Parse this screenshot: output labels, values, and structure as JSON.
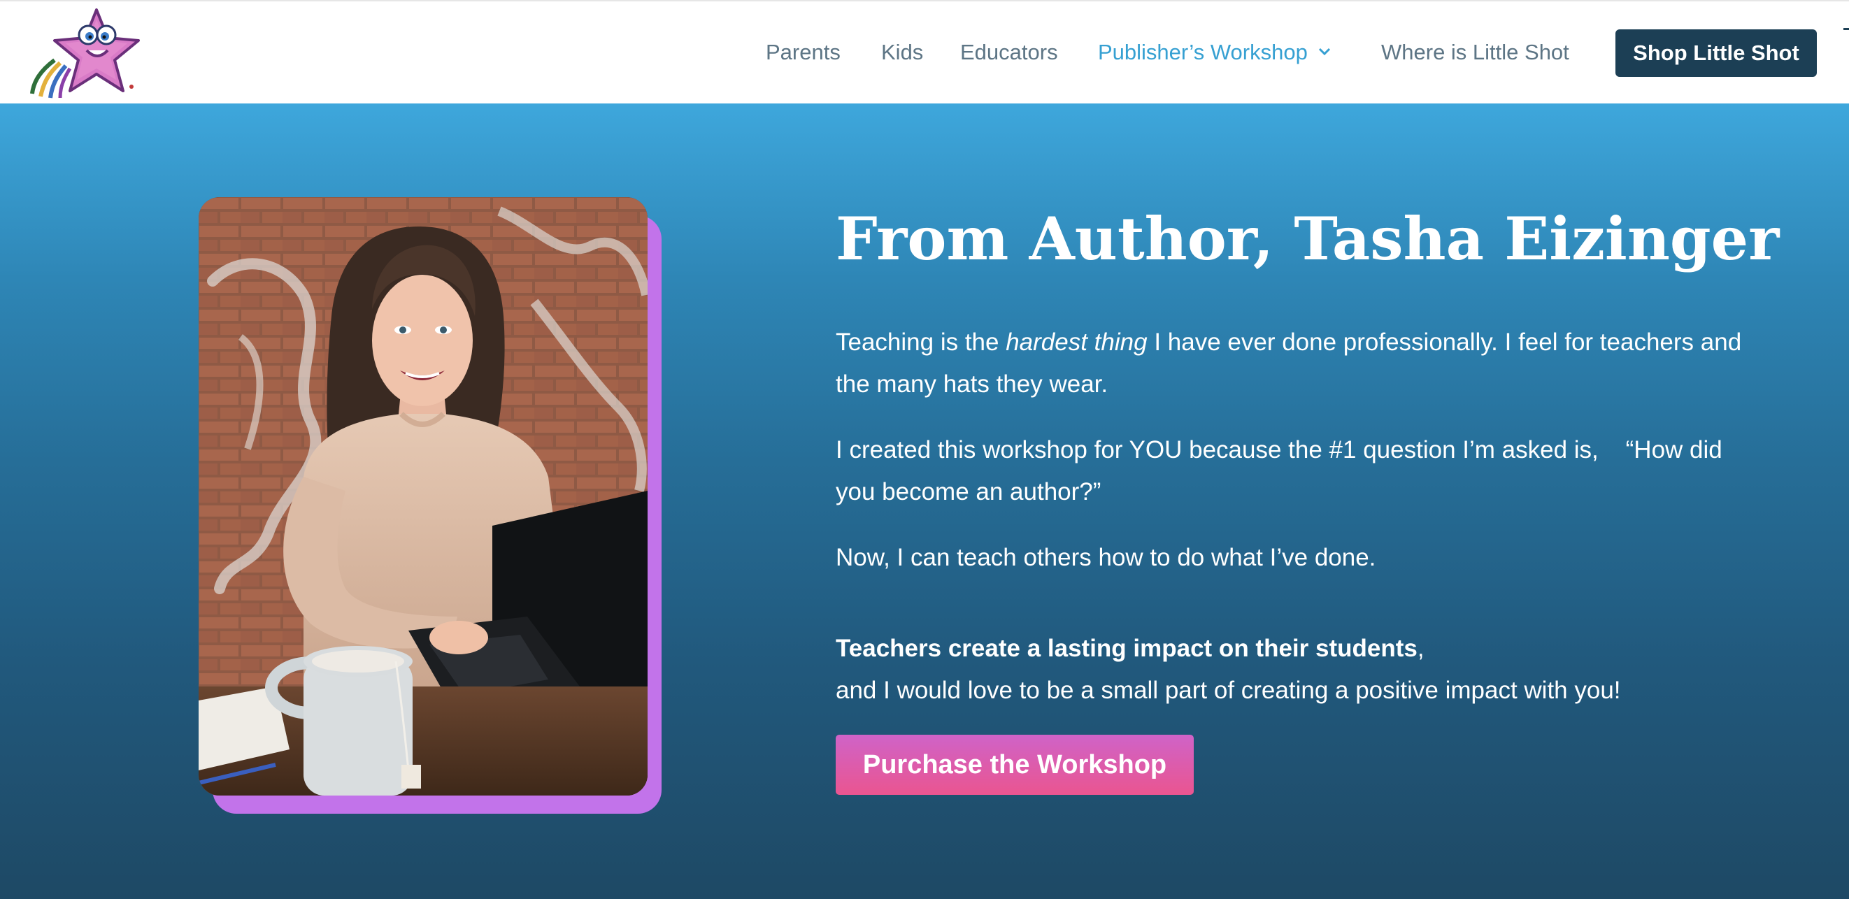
{
  "header": {
    "logo_alt": "Little Shot",
    "nav": [
      {
        "label": "Parents"
      },
      {
        "label": "Kids"
      },
      {
        "label": "Educators"
      },
      {
        "label": "Publisher’s Workshop"
      },
      {
        "label": "Where is Little Shot"
      }
    ],
    "shop_button": "Shop Little Shot"
  },
  "hero": {
    "title": "From Author, Tasha Eizinger",
    "p1_before": "Teaching is the ",
    "p1_em": "hardest thing",
    "p1_after": " I have ever done professionally. I feel for teachers and the many hats they wear.",
    "p2": "I created this workshop for YOU because the #1 question I’m asked is,    “How did you become an author?”",
    "p3": "Now, I can teach others how to do what I’ve done.",
    "p4_strong": "Teachers create a lasting impact on their students",
    "p4_comma": ",",
    "p4_line2": "and I would love to be a small part of creating a positive impact with you!",
    "cta": "Purchase the Workshop",
    "photo_alt": "Tasha Eizinger at a laptop with a mug"
  },
  "colors": {
    "nav_text": "#5d7585",
    "nav_active": "#36a0d2",
    "shop_button_bg": "#1c3f55",
    "hero_top": "#3ea7dc",
    "hero_bottom": "#1e4965",
    "photo_accent": "#c273ea",
    "cta_top": "#cf63c8",
    "cta_bottom": "#ea5590"
  },
  "icons": {
    "logo": "starfish-logo",
    "nav_dropdown": "chevron-down-icon"
  }
}
